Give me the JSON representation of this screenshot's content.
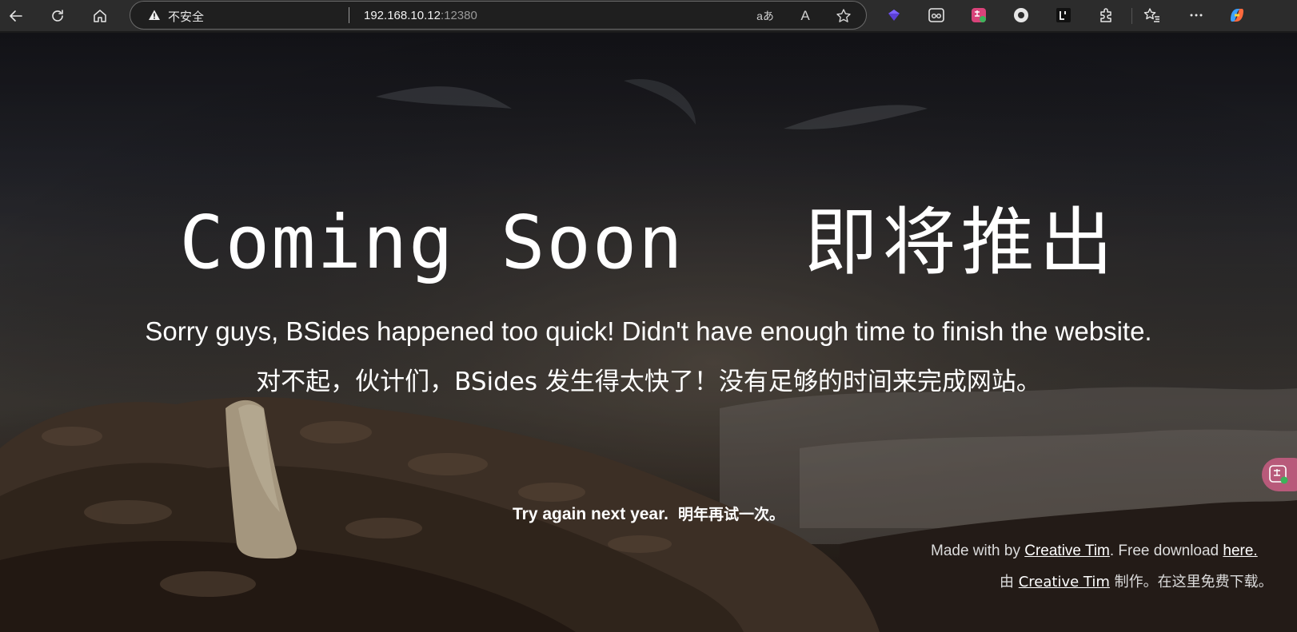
{
  "browser": {
    "security_label": "不安全",
    "url_host": "192.168.10.12",
    "url_port": ":12380",
    "read_aloud_label": "A",
    "translate_label": "aあ"
  },
  "page": {
    "headline_en": "Coming Soon",
    "headline_zh": "即将推出",
    "sorry_en": "Sorry guys, BSides happened too quick! Didn't have enough time to finish the website.",
    "sorry_zh": "对不起，伙计们，BSides 发生得太快了！没有足够的时间来完成网站。",
    "try_again_en": "Try again next year.",
    "try_again_zh": "明年再试一次。",
    "credit_en_prefix": "Made with by ",
    "credit_en_link": "Creative Tim",
    "credit_en_middle": ". Free download ",
    "credit_en_here": "here.",
    "credit_zh_prefix": "由 ",
    "credit_zh_link": "Creative Tim",
    "credit_zh_suffix": " 制作。在这里免费下载。"
  },
  "icons": {
    "back": "arrow-left-icon",
    "reload": "refresh-icon",
    "home": "home-icon",
    "warning": "warning-triangle-icon",
    "favorite": "star-icon",
    "extensions": "puzzle-icon",
    "favorites_bar": "star-list-icon",
    "menu": "more-horizontal-icon",
    "copilot": "copilot-icon"
  },
  "colors": {
    "chrome_bg": "#2c2c2c",
    "address_bg": "#1f1f1f",
    "text_white": "#ffffff",
    "float_button": "#b85a7a"
  }
}
